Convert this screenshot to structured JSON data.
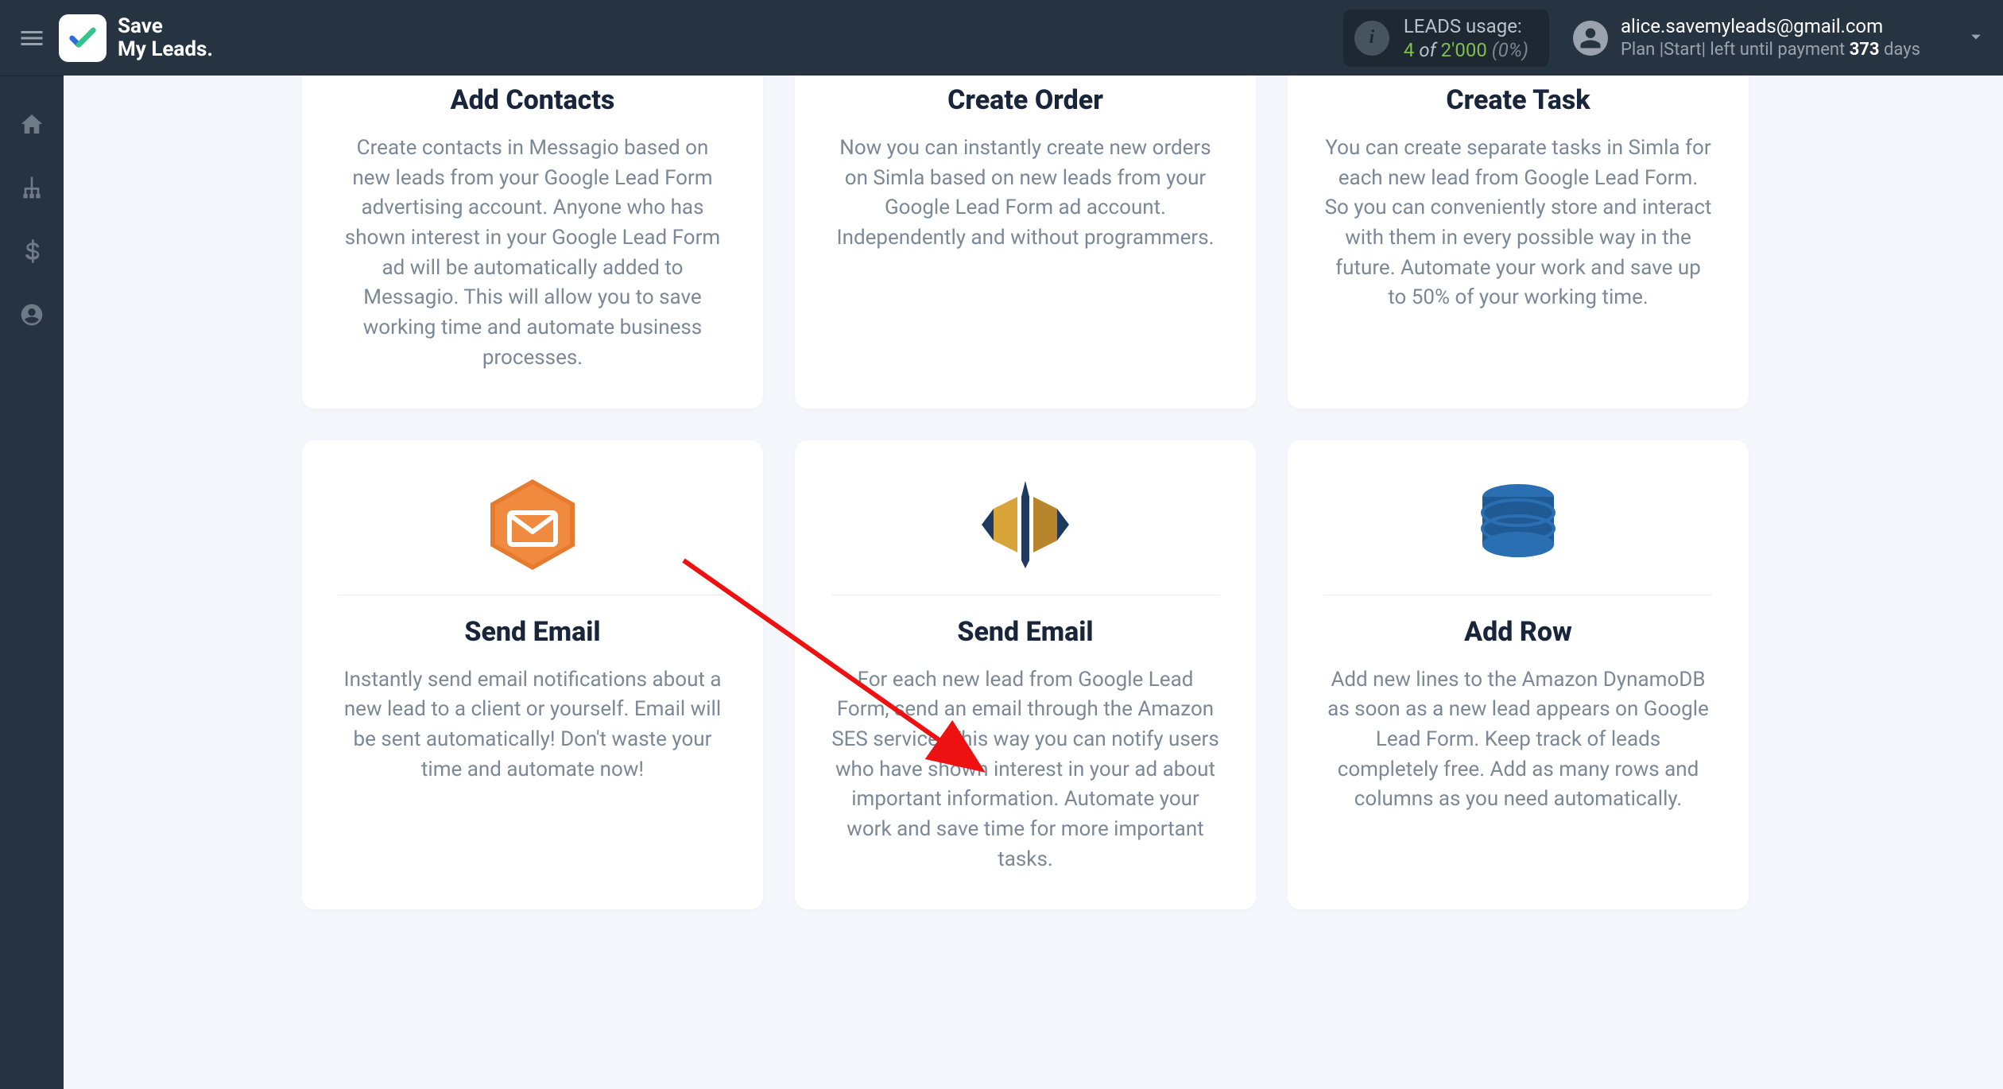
{
  "brand": {
    "line1": "Save",
    "line2": "My Leads."
  },
  "leads": {
    "label": "LEADS usage:",
    "used": "4",
    "of": "of",
    "total": "2'000",
    "pct": "(0%)"
  },
  "user": {
    "email": "alice.savemyleads@gmail.com",
    "plan_prefix": "Plan |Start| left until payment ",
    "days": "373",
    "days_suffix": " days"
  },
  "cards": {
    "r1c1": {
      "title": "Add Contacts",
      "desc": "Create contacts in Messagio based on new leads from your Google Lead Form advertising account. Anyone who has shown interest in your Google Lead Form ad will be automatically added to Messagio. This will allow you to save working time and automate business processes."
    },
    "r1c2": {
      "title": "Create Order",
      "desc": "Now you can instantly create new orders on Simla based on new leads from your Google Lead Form ad account. Independently and without programmers."
    },
    "r1c3": {
      "title": "Create Task",
      "desc": "You can create separate tasks in Simla for each new lead from Google Lead Form. So you can conveniently store and interact with them in every possible way in the future. Automate your work and save up to 50% of your working time."
    },
    "r2c1": {
      "title": "Send Email",
      "desc": "Instantly send email notifications about a new lead to a client or yourself. Email will be sent automatically! Don't waste your time and automate now!"
    },
    "r2c2": {
      "title": "Send Email",
      "desc": "For each new lead from Google Lead Form, send an email through the Amazon SES service. This way you can notify users who have shown interest in your ad about important information. Automate your work and save time for more important tasks."
    },
    "r2c3": {
      "title": "Add Row",
      "desc": "Add new lines to the Amazon DynamoDB as soon as a new lead appears on Google Lead Form. Keep track of leads completely free. Add as many rows and columns as you need automatically."
    }
  }
}
